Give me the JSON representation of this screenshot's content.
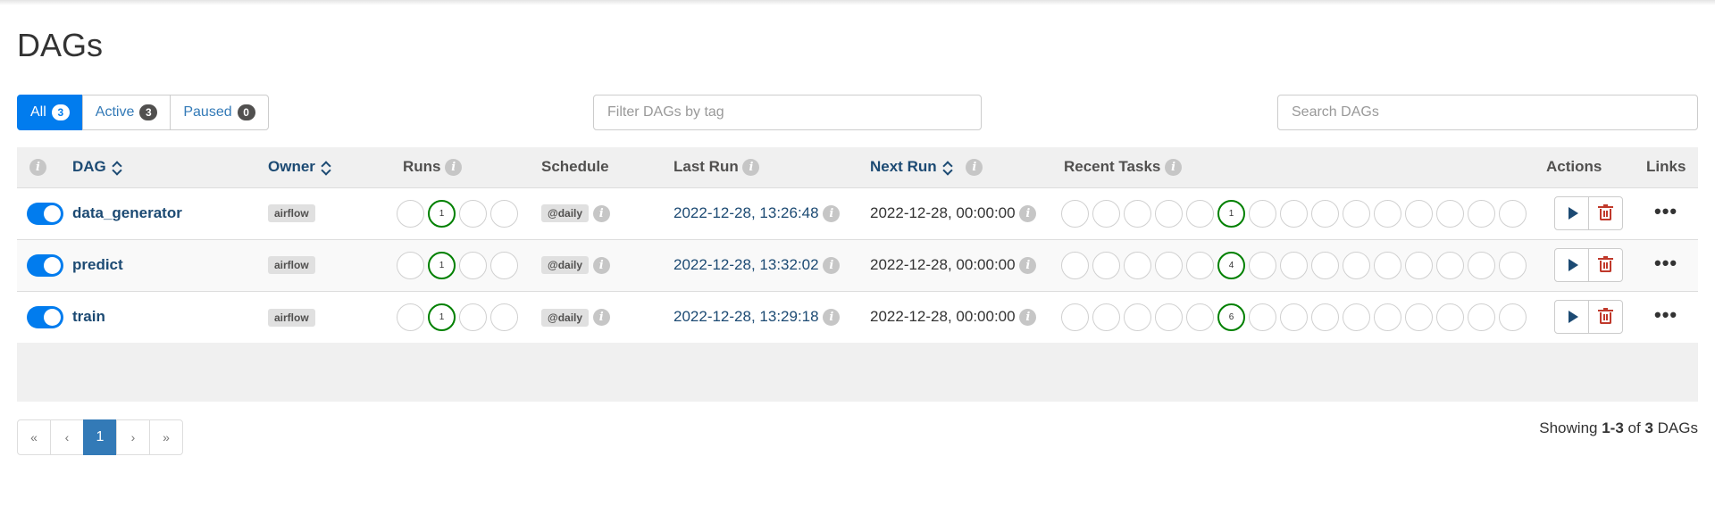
{
  "page": {
    "title": "DAGs"
  },
  "filters": {
    "all": {
      "label": "All",
      "count": "3"
    },
    "active": {
      "label": "Active",
      "count": "3"
    },
    "paused": {
      "label": "Paused",
      "count": "0"
    },
    "tag_placeholder": "Filter DAGs by tag",
    "search_placeholder": "Search DAGs"
  },
  "table": {
    "headers": {
      "dag": "DAG",
      "owner": "Owner",
      "runs": "Runs",
      "schedule": "Schedule",
      "last_run": "Last Run",
      "next_run": "Next Run",
      "recent_tasks": "Recent Tasks",
      "actions": "Actions",
      "links": "Links"
    },
    "rows": [
      {
        "name": "data_generator",
        "owner": "airflow",
        "runs_success": "1",
        "schedule": "@daily",
        "last_run": "2022-12-28, 13:26:48",
        "next_run": "2022-12-28, 00:00:00",
        "tasks_success": "1"
      },
      {
        "name": "predict",
        "owner": "airflow",
        "runs_success": "1",
        "schedule": "@daily",
        "last_run": "2022-12-28, 13:32:02",
        "next_run": "2022-12-28, 00:00:00",
        "tasks_success": "4"
      },
      {
        "name": "train",
        "owner": "airflow",
        "runs_success": "1",
        "schedule": "@daily",
        "last_run": "2022-12-28, 13:29:18",
        "next_run": "2022-12-28, 00:00:00",
        "tasks_success": "6"
      }
    ]
  },
  "pagination": {
    "first": "«",
    "prev": "‹",
    "current": "1",
    "next": "›",
    "last": "»"
  },
  "footer": {
    "showing_prefix": "Showing",
    "range": "1-3",
    "of": "of",
    "total": "3",
    "suffix": "DAGs"
  },
  "icons": {
    "info": "info-icon",
    "sort": "sort-icon",
    "play": "play-icon",
    "delete": "trash-icon",
    "more": "more-icon"
  },
  "colors": {
    "accent": "#017cee",
    "success": "#008000",
    "link": "#1c4a73",
    "danger": "#c0392b"
  }
}
